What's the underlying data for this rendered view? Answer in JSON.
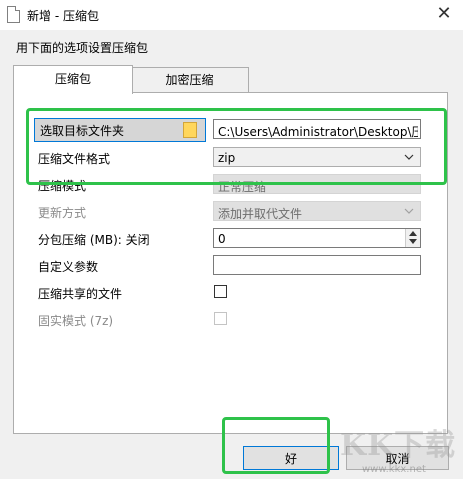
{
  "window": {
    "title": "新增 - 压缩包",
    "close_glyph": "✕"
  },
  "description": "用下面的选项设置压缩包",
  "tabs": [
    {
      "label": "压缩包",
      "active": true
    },
    {
      "label": "加密压缩",
      "active": false
    }
  ],
  "fields": {
    "target": {
      "button_label": "选取目标文件夹",
      "value": "C:\\Users\\Administrator\\Desktop\\压"
    },
    "format": {
      "label": "压缩文件格式",
      "value": "zip"
    },
    "mode": {
      "label": "压缩模式",
      "value": "正常压缩"
    },
    "update": {
      "label": "更新方式",
      "value": "添加并取代文件"
    },
    "split": {
      "label": "分包压缩 (MB): 关闭",
      "value": "0"
    },
    "custom": {
      "label": "自定义参数",
      "value": ""
    },
    "shared": {
      "label": "压缩共享的文件",
      "checked": false
    },
    "solid": {
      "label": "固实模式 (7z)",
      "checked": false
    }
  },
  "buttons": {
    "ok": "好",
    "cancel": "取消"
  },
  "watermark": {
    "text1": "KK下载",
    "text2": "www.kkx.net"
  },
  "colors": {
    "highlight": "#2ec24a",
    "focus": "#0078d7"
  }
}
